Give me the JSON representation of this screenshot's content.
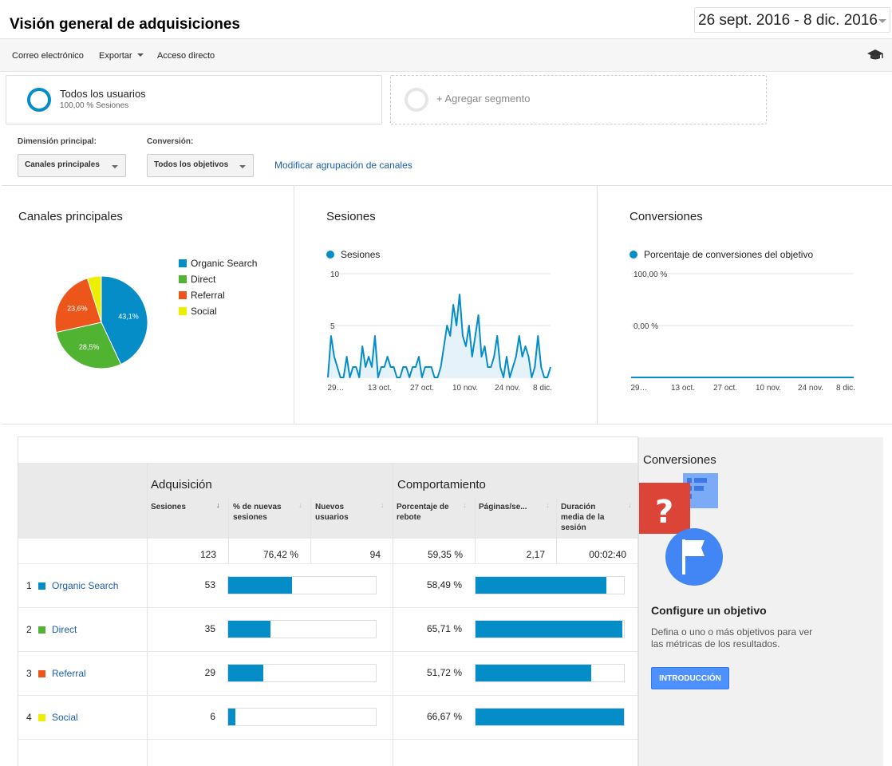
{
  "header": {
    "title": "Visión general de adquisiciones",
    "date_range": "26 sept. 2016 - 8 dic. 2016"
  },
  "toolbar": {
    "email": "Correo electrónico",
    "export": "Exportar",
    "shortcut": "Acceso directo",
    "help_icon": "graduation-cap-icon"
  },
  "segments": {
    "active_name": "Todos los usuarios",
    "active_sub": "100,00 % Sesiones",
    "add_label": "+ Agregar segmento"
  },
  "dimensions": {
    "primary_label": "Dimensión principal:",
    "primary_value": "Canales principales",
    "conversion_label": "Conversión:",
    "conversion_value": "Todos los objetivos",
    "modify_link": "Modificar agrupación de canales"
  },
  "colors": {
    "organic": "#058dc7",
    "direct": "#50b432",
    "referral": "#ed561b",
    "social": "#edef00",
    "line": "#058dc7",
    "link": "#1a5fb4"
  },
  "panels": {
    "channels_title": "Canales principales",
    "sessions_title": "Sesiones",
    "conversions_title": "Conversiones"
  },
  "chart_data": [
    {
      "type": "pie",
      "title": "Canales principales",
      "categories": [
        "Organic Search",
        "Direct",
        "Referral",
        "Social"
      ],
      "values": [
        43.1,
        28.5,
        23.6,
        4.9
      ],
      "labels": [
        "43,1%",
        "28,5%",
        "23,6%",
        ""
      ],
      "legend": "right"
    },
    {
      "type": "area",
      "title": "Sesiones",
      "series": [
        {
          "name": "Sesiones",
          "values": [
            0,
            4,
            2,
            1,
            0,
            0,
            2,
            0,
            1,
            1,
            0,
            3,
            1,
            2,
            1,
            4,
            0,
            1,
            1,
            2,
            1,
            1,
            0,
            0,
            1,
            1,
            0,
            1,
            1,
            2,
            0,
            1,
            1,
            1,
            0,
            0,
            1,
            3,
            5,
            4,
            7,
            5,
            8,
            4,
            3,
            5,
            2,
            4,
            6,
            2,
            3,
            1,
            1,
            2,
            4,
            1,
            0,
            2,
            0,
            1,
            2,
            4,
            2,
            3,
            2,
            0,
            1,
            4,
            1,
            0,
            0,
            1
          ]
        }
      ],
      "x_ticks": [
        "29…",
        "13 oct.",
        "27 oct.",
        "10 nov.",
        "24 nov.",
        "8 dic."
      ],
      "y_ticks": [
        "10",
        "5"
      ],
      "ylim": [
        0,
        10
      ]
    },
    {
      "type": "line",
      "title": "Conversiones",
      "series": [
        {
          "name": "Porcentaje de conversiones del objetivo",
          "values": [
            0,
            0
          ]
        }
      ],
      "x_ticks": [
        "29…",
        "13 oct.",
        "27 oct.",
        "10 nov.",
        "24 nov.",
        "8 dic."
      ],
      "y_ticks": [
        "100,00 %",
        "0,00 %"
      ],
      "ylim": [
        0,
        100
      ]
    }
  ],
  "table": {
    "group_acquisition": "Adquisición",
    "group_behavior": "Comportamiento",
    "columns": [
      "Sesiones",
      "% de nuevas sesiones",
      "Nuevos usuarios",
      "Porcentaje de rebote",
      "Páginas/se...",
      "Duración media de la sesión"
    ],
    "totals": [
      "123",
      "76,42 %",
      "94",
      "59,35 %",
      "2,17",
      "00:02:40"
    ],
    "rows": [
      {
        "rank": "1",
        "channel": "Organic Search",
        "sessions": "53",
        "sessions_frac": 0.431,
        "bounce": "58,49 %",
        "bounce_frac": 0.88
      },
      {
        "rank": "2",
        "channel": "Direct",
        "sessions": "35",
        "sessions_frac": 0.285,
        "bounce": "65,71 %",
        "bounce_frac": 0.99
      },
      {
        "rank": "3",
        "channel": "Referral",
        "sessions": "29",
        "sessions_frac": 0.236,
        "bounce": "51,72 %",
        "bounce_frac": 0.78
      },
      {
        "rank": "4",
        "channel": "Social",
        "sessions": "6",
        "sessions_frac": 0.049,
        "bounce": "66,67 %",
        "bounce_frac": 1.0
      }
    ]
  },
  "goal_card": {
    "title": "Conversiones",
    "heading": "Configure un objetivo",
    "description": "Defina o uno o más objetivos para ver las métricas de los resultados.",
    "button": "INTRODUCCIÓN",
    "illustration": "goal-flag-illustration"
  }
}
